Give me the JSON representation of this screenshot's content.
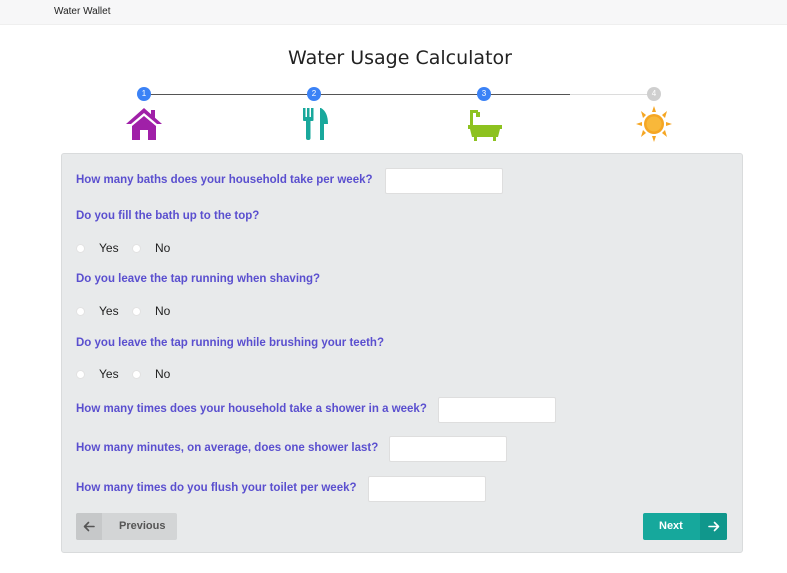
{
  "navbar": {
    "brand": "Water Wallet"
  },
  "page": {
    "title": "Water Usage Calculator"
  },
  "stepper": {
    "steps": [
      {
        "number": "1",
        "icon": "house-icon",
        "status": "complete",
        "color": "#a020a8"
      },
      {
        "number": "2",
        "icon": "fork-knife-icon",
        "status": "complete",
        "color": "#19a89c"
      },
      {
        "number": "3",
        "icon": "bathtub-icon",
        "status": "current",
        "color": "#8dc21f"
      },
      {
        "number": "4",
        "icon": "sun-icon",
        "status": "upcoming",
        "color": "#f5a623"
      }
    ],
    "active_color": "#3b82f6"
  },
  "form": {
    "q_baths": "How many baths does your household take per week?",
    "q_fill_bath": "Do you fill the bath up to the top?",
    "q_tap_shaving": "Do you leave the tap running when shaving?",
    "q_tap_brushing": "Do you leave the tap running while brushing your teeth?",
    "q_showers": "How many times does your household take a shower in a week?",
    "q_shower_minutes": "How many minutes, on average, does one shower last?",
    "q_flush": "How many times do you flush your toilet per week?",
    "yes": "Yes",
    "no": "No",
    "values": {
      "baths": "",
      "showers": "",
      "shower_minutes": "",
      "flush": ""
    },
    "question_color": "#5a4fcf"
  },
  "buttons": {
    "previous": "Previous",
    "next": "Next",
    "next_color": "#16a89c"
  }
}
